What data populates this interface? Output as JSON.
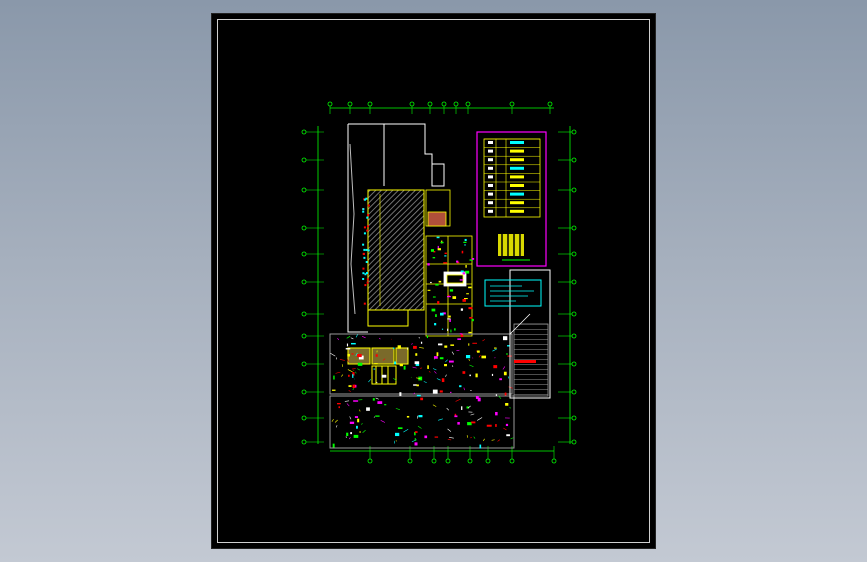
{
  "viewer": {
    "background_top": "#8a98aa",
    "background_bottom": "#c3c9d3"
  },
  "drawing": {
    "sheet_color": "#000000",
    "frame_color": "#cfcfcf",
    "colors": {
      "grid": "#00ff00",
      "dimension": "#00ff00",
      "wall": "#ffffff",
      "yellow": "#ffff00",
      "magenta": "#ff00ff",
      "cyan": "#00ffff",
      "red": "#ff0000",
      "hatch": "#8c8c8c"
    },
    "icons": {
      "grid_bubble": "circle",
      "north_hatch": "diagonal-hatch"
    }
  }
}
